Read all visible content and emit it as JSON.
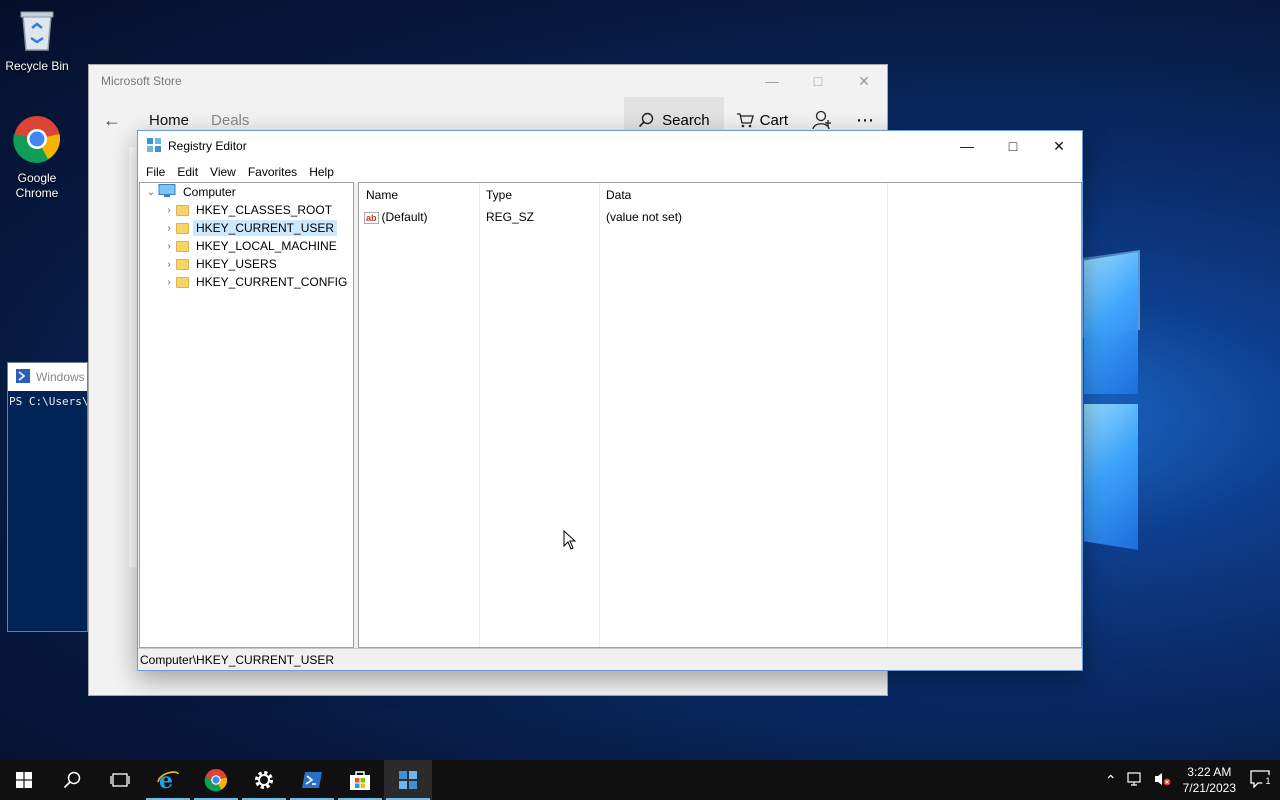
{
  "desktop": {
    "icons": [
      {
        "label": "Recycle Bin",
        "icon": "recycle-bin-icon"
      },
      {
        "label": "Google Chrome",
        "icon": "chrome-icon"
      }
    ]
  },
  "store": {
    "title": "Microsoft Store",
    "nav": {
      "home": "Home",
      "deals": "Deals",
      "search": "Search",
      "cart": "Cart"
    }
  },
  "powershell": {
    "title": "Windows",
    "prompt": "PS C:\\Users\\"
  },
  "regedit": {
    "title": "Registry Editor",
    "menu": [
      "File",
      "Edit",
      "View",
      "Favorites",
      "Help"
    ],
    "tree": {
      "root": "Computer",
      "keys": [
        "HKEY_CLASSES_ROOT",
        "HKEY_CURRENT_USER",
        "HKEY_LOCAL_MACHINE",
        "HKEY_USERS",
        "HKEY_CURRENT_CONFIG"
      ],
      "selected": "HKEY_CURRENT_USER"
    },
    "columns": {
      "name": "Name",
      "type": "Type",
      "data": "Data"
    },
    "values": [
      {
        "name": "(Default)",
        "type": "REG_SZ",
        "data": "(value not set)"
      }
    ],
    "status": "Computer\\HKEY_CURRENT_USER"
  },
  "taskbar": {
    "apps": [
      "start",
      "search",
      "task-view",
      "edge",
      "chrome",
      "settings",
      "powershell",
      "store",
      "regedit"
    ],
    "time": "3:22 AM",
    "date": "7/21/2023",
    "notification_count": "1"
  }
}
